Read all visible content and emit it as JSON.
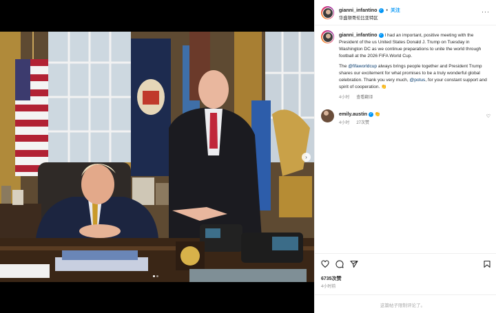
{
  "post": {
    "author": "gianni_infantino",
    "location": "华盛顿哥伦比亚特区",
    "follow_label": "关注",
    "more_label": "···"
  },
  "caption": {
    "author": "gianni_infantino",
    "para1": "I had an important, positive meeting with the President of the us United States Donald J. Trump on Tuesday in Washington DC as we continue preparations to unite the world through football at the 2026 FIFA World Cup.",
    "para2_a": "The ",
    "mention1": "@fifaworldcup",
    "para2_b": " always brings people together and President Trump shares our excitement for what promises to be a truly wonderful global celebration. Thank you very much, ",
    "mention2": "@potus",
    "para2_c": ", for your constant support and spirit of cooperation. 👏",
    "time": "4小时",
    "see_translation": "查看翻译"
  },
  "comments": [
    {
      "user": "emily.austin",
      "emoji": "👏",
      "time": "4小时",
      "likes": "27次赞"
    }
  ],
  "stats": {
    "likes": "6735次赞",
    "time": "4小时前"
  },
  "add_comment": {
    "text": "这篇帖子限制评论了。"
  },
  "icons": {
    "like": "heart-icon",
    "comment": "comment-icon",
    "share": "share-icon",
    "save": "bookmark-icon",
    "next": "chevron-right-icon"
  },
  "colors": {
    "accent": "#0095f6",
    "link": "#00376b",
    "muted": "#8e8e8e"
  }
}
